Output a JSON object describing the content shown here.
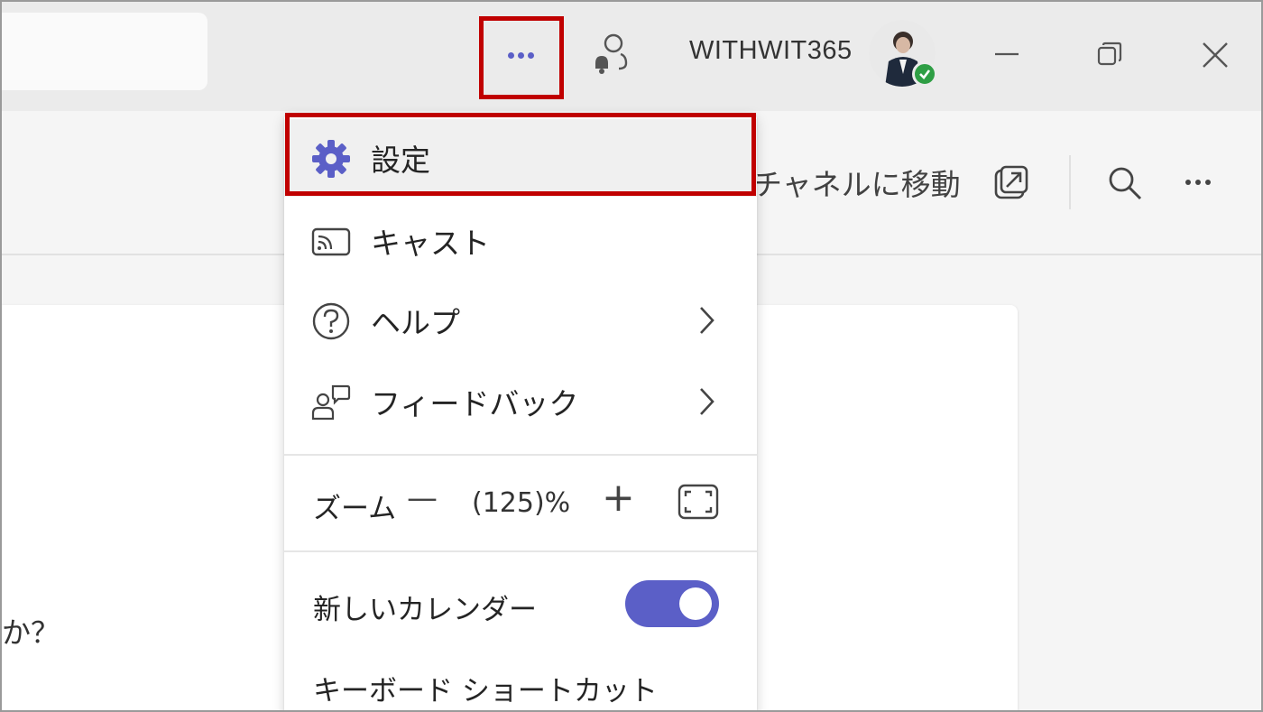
{
  "titlebar": {
    "username": "WITHWIT365",
    "more_icon": "more-horizontal-icon",
    "activity_icon": "people-bell-icon",
    "minimize_icon": "minimize-icon",
    "restore_icon": "restore-icon",
    "close_icon": "close-icon"
  },
  "header": {
    "channel_link": "チャネルに移動",
    "popout_icon": "popout-icon",
    "search_icon": "search-icon",
    "more_icon": "more-horizontal-icon"
  },
  "content": {
    "text": "か？"
  },
  "menu": {
    "items": [
      {
        "label": "設定",
        "icon": "gear-icon"
      },
      {
        "label": "キャスト",
        "icon": "cast-icon"
      },
      {
        "label": "ヘルプ",
        "icon": "help-circle-icon",
        "submenu": true
      },
      {
        "label": "フィードバック",
        "icon": "feedback-icon",
        "submenu": true
      }
    ],
    "zoom": {
      "label": "ズーム",
      "minus": "—",
      "value": "(125)%",
      "plus": "+"
    },
    "new_calendar": {
      "label": "新しいカレンダー",
      "enabled": true
    },
    "shortcuts": {
      "label": "キーボード ショートカット"
    }
  },
  "colors": {
    "accent": "#5b5fc7",
    "highlight": "#c00000",
    "presence": "#2e9e44"
  }
}
